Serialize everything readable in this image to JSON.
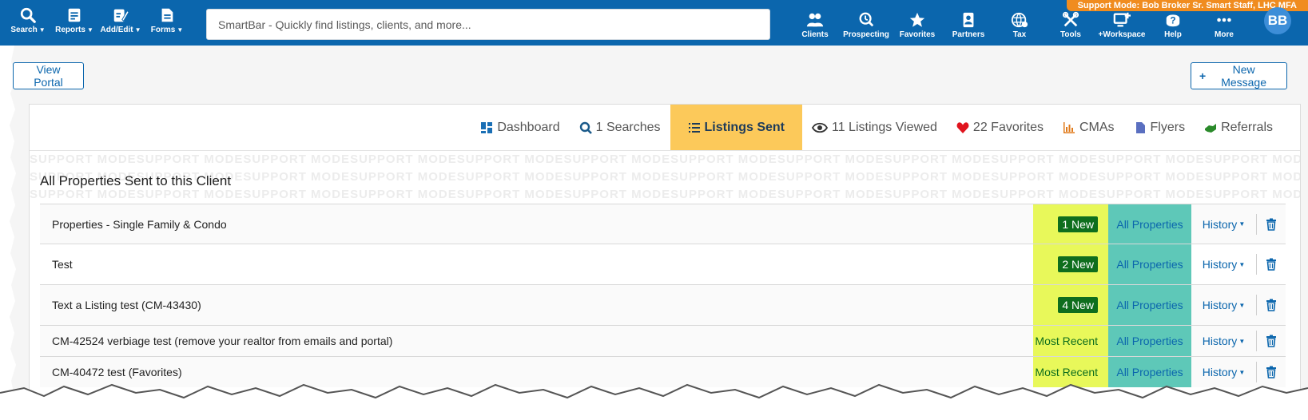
{
  "support_banner": "Support Mode: Bob Broker Sr. Smart Staff, LHC MFA",
  "nav_left": [
    {
      "label": "Search",
      "icon": "search-icon",
      "has_caret": true
    },
    {
      "label": "Reports",
      "icon": "reports-icon",
      "has_caret": true
    },
    {
      "label": "Add/Edit",
      "icon": "edit-icon",
      "has_caret": true
    },
    {
      "label": "Forms",
      "icon": "forms-icon",
      "has_caret": true
    }
  ],
  "smartbar": {
    "placeholder": "SmartBar - Quickly find listings, clients, and more..."
  },
  "nav_right": [
    {
      "label": "Clients",
      "icon": "clients-icon"
    },
    {
      "label": "Prospecting",
      "icon": "prospecting-icon"
    },
    {
      "label": "Favorites",
      "icon": "star-icon"
    },
    {
      "label": "Partners",
      "icon": "partners-icon"
    },
    {
      "label": "Tax",
      "icon": "tax-icon"
    },
    {
      "label": "Tools",
      "icon": "tools-icon"
    },
    {
      "label": "+Workspace",
      "icon": "workspace-icon"
    },
    {
      "label": "Help",
      "icon": "help-icon"
    },
    {
      "label": "More",
      "icon": "more-icon"
    }
  ],
  "avatar": "BB",
  "actions": {
    "view_portal": "View Portal",
    "new_message": "New Message"
  },
  "tabs": [
    {
      "label": "Dashboard",
      "icon": "dashboard-icon",
      "active": false
    },
    {
      "label": "1 Searches",
      "icon": "search-icon",
      "active": false
    },
    {
      "label": "Listings Sent",
      "icon": "list-icon",
      "active": true
    },
    {
      "label": "11 Listings Viewed",
      "icon": "eye-icon",
      "active": false
    },
    {
      "label": "22 Favorites",
      "icon": "heart-icon",
      "active": false
    },
    {
      "label": "CMAs",
      "icon": "chart-icon",
      "active": false
    },
    {
      "label": "Flyers",
      "icon": "file-icon",
      "active": false
    },
    {
      "label": "Referrals",
      "icon": "handshake-icon",
      "active": false
    }
  ],
  "watermark": "SUPPORT MODE",
  "heading": "All Properties Sent to this Client",
  "rows": [
    {
      "name": "Properties - Single Family & Condo",
      "status": "1 New",
      "status_type": "badge",
      "props": "All Properties",
      "history": "History"
    },
    {
      "name": "Test",
      "status": "2 New",
      "status_type": "badge",
      "props": "All Properties",
      "history": "History"
    },
    {
      "name": "Text a Listing test (CM-43430)",
      "status": "4 New",
      "status_type": "badge",
      "props": "All Properties",
      "history": "History"
    },
    {
      "name": "CM-42524 verbiage test (remove your realtor from emails and portal)",
      "status": "Most Recent",
      "status_type": "text",
      "props": "All Properties",
      "history": "History"
    },
    {
      "name": "CM-40472 test (Favorites)",
      "status": "Most Recent",
      "status_type": "text",
      "props": "All Properties",
      "history": "History"
    }
  ],
  "colors": {
    "nav": "#0b66ad",
    "banner": "#f08c1f",
    "active_tab": "#fcc95a",
    "new_col": "#e8f85a",
    "props_col": "#5ec8b8",
    "badge": "#0e6e1d"
  }
}
